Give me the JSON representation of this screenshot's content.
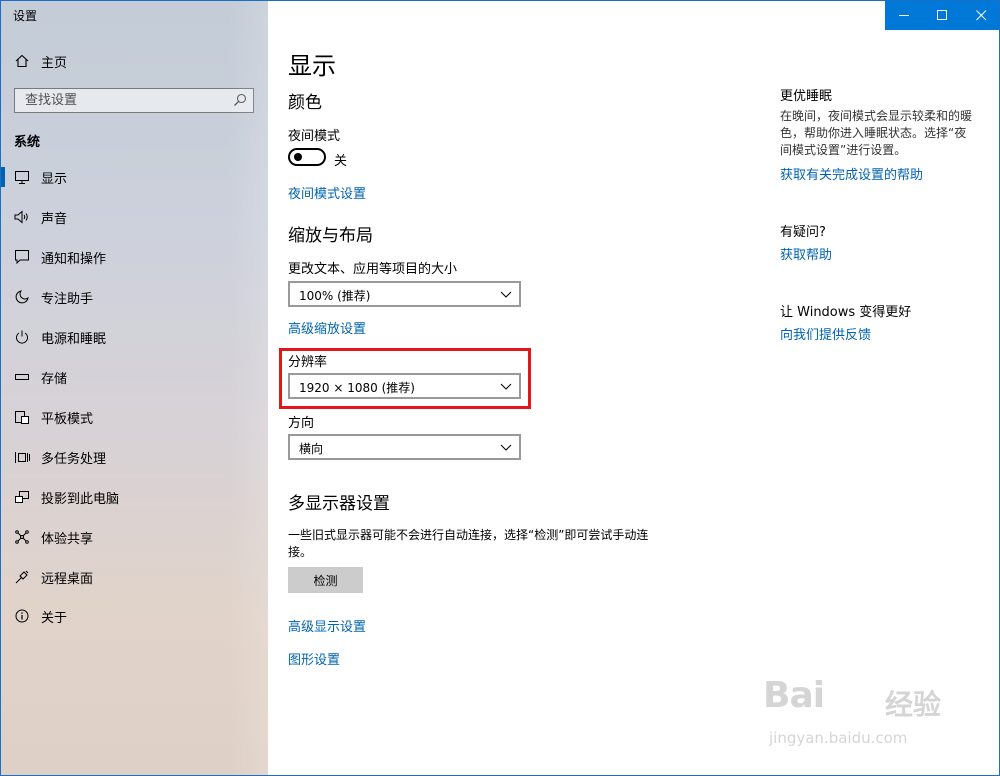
{
  "window": {
    "title": "设置"
  },
  "titlebar": {
    "minimize": "—",
    "maximize": "☐",
    "close": "✕"
  },
  "sidebar": {
    "home_label": "主页",
    "search_placeholder": "查找设置",
    "section_label": "系统",
    "items": [
      {
        "label": "显示",
        "icon": "monitor-icon",
        "active": true
      },
      {
        "label": "声音",
        "icon": "speaker-icon"
      },
      {
        "label": "通知和操作",
        "icon": "notification-icon"
      },
      {
        "label": "专注助手",
        "icon": "moon-icon"
      },
      {
        "label": "电源和睡眠",
        "icon": "power-icon"
      },
      {
        "label": "存储",
        "icon": "storage-icon"
      },
      {
        "label": "平板模式",
        "icon": "tablet-icon"
      },
      {
        "label": "多任务处理",
        "icon": "multitask-icon"
      },
      {
        "label": "投影到此电脑",
        "icon": "project-icon"
      },
      {
        "label": "体验共享",
        "icon": "share-icon"
      },
      {
        "label": "远程桌面",
        "icon": "remote-icon"
      },
      {
        "label": "关于",
        "icon": "info-icon"
      }
    ]
  },
  "main": {
    "page_title": "显示",
    "color_heading": "颜色",
    "night_mode_label": "夜间模式",
    "night_mode_state": "关",
    "night_mode_settings_link": "夜间模式设置",
    "scale_heading": "缩放与布局",
    "scale_label": "更改文本、应用等项目的大小",
    "scale_value": "100% (推荐)",
    "advanced_scale_link": "高级缩放设置",
    "resolution_label": "分辨率",
    "resolution_value": "1920 × 1080 (推荐)",
    "orientation_label": "方向",
    "orientation_value": "横向",
    "multi_display_heading": "多显示器设置",
    "multi_display_desc_line1": "一些旧式显示器可能不会进行自动连接，选择“检测”即可尝试手动连",
    "multi_display_desc_line2": "接。",
    "detect_button": "检测",
    "advanced_display_link": "高级显示设置",
    "graphics_link": "图形设置"
  },
  "side_panel": {
    "sleep_heading": "更优睡眠",
    "sleep_desc_line1": "在晚间，夜间模式会显示较柔和的暖",
    "sleep_desc_line2": "色，帮助你进入睡眠状态。选择“夜",
    "sleep_desc_line3": "间模式设置”进行设置。",
    "sleep_help_link": "获取有关完成设置的帮助",
    "question_heading": "有疑问?",
    "get_help_link": "获取帮助",
    "improve_heading": "让 Windows 变得更好",
    "feedback_link": "向我们提供反馈"
  },
  "watermark": {
    "brand": "Bai",
    "brand_cn": "经验",
    "url": "jingyan.baidu.com"
  },
  "colors": {
    "accent": "#0078d7",
    "link": "#0063b1",
    "highlight": "#e5151c"
  }
}
